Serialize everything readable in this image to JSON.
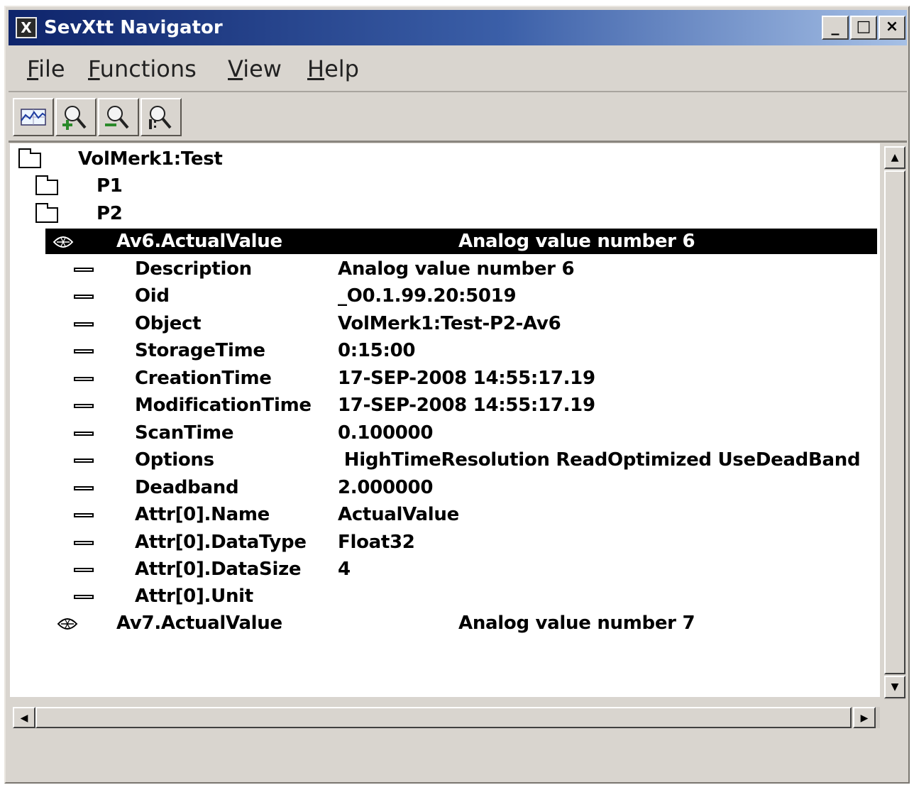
{
  "window": {
    "title": "SevXtt Navigator",
    "app_icon": "X",
    "controls": {
      "minimize": "_",
      "maximize": "□",
      "close": "×"
    }
  },
  "menu": [
    {
      "label": "File",
      "mnemonic": "F",
      "rest": "ile"
    },
    {
      "label": "Functions",
      "mnemonic": "F",
      "rest": "unctions"
    },
    {
      "label": "View",
      "mnemonic": "V",
      "rest": "iew"
    },
    {
      "label": "Help",
      "mnemonic": "H",
      "rest": "elp"
    }
  ],
  "toolbar": {
    "icons": [
      "trend-curve-icon",
      "zoom-in-icon",
      "zoom-out-icon",
      "zoom-reset-icon"
    ]
  },
  "tree": {
    "root": {
      "label": "VolMerk1:Test"
    },
    "p1": {
      "label": "P1"
    },
    "p2": {
      "label": "P2"
    },
    "av6": {
      "name": "Av6.ActualValue",
      "description": "Analog value number 6"
    },
    "attributes": [
      {
        "name": "Description",
        "value": "Analog value number 6"
      },
      {
        "name": "Oid",
        "value": "_O0.1.99.20:5019"
      },
      {
        "name": "Object",
        "value": "VolMerk1:Test-P2-Av6"
      },
      {
        "name": "StorageTime",
        "value": "0:15:00"
      },
      {
        "name": "CreationTime",
        "value": "17-SEP-2008 14:55:17.19"
      },
      {
        "name": "ModificationTime",
        "value": "17-SEP-2008 14:55:17.19"
      },
      {
        "name": "ScanTime",
        "value": "0.100000"
      },
      {
        "name": "Options",
        "value": " HighTimeResolution ReadOptimized UseDeadBand"
      },
      {
        "name": "Deadband",
        "value": "2.000000"
      },
      {
        "name": "Attr[0].Name",
        "value": "ActualValue"
      },
      {
        "name": "Attr[0].DataType",
        "value": "Float32"
      },
      {
        "name": "Attr[0].DataSize",
        "value": "4"
      },
      {
        "name": "Attr[0].Unit",
        "value": ""
      }
    ],
    "av7": {
      "name": "Av7.ActualValue",
      "description": "Analog value number 7"
    }
  },
  "scrollbars": {
    "up": "▲",
    "down": "▼",
    "left": "◀",
    "right": "▶"
  }
}
